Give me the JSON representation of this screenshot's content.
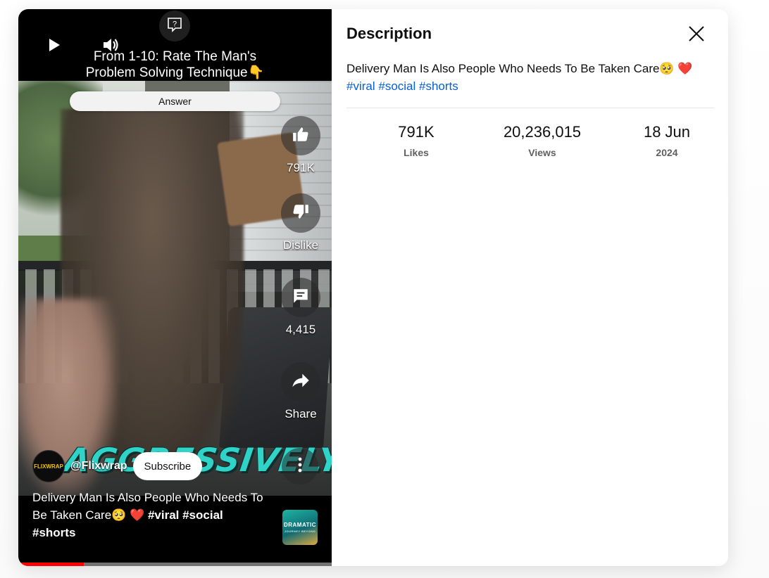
{
  "video": {
    "caption_line1": "From 1-10: Rate The Man's",
    "caption_line2": "Problem Solving Technique👇",
    "answer_label": "Answer",
    "overlay_text": "AGGRESSIVELY",
    "actions": {
      "like_count": "791K",
      "dislike_label": "Dislike",
      "comment_count": "4,415",
      "share_label": "Share"
    },
    "channel": {
      "avatar_text": "FLIXWRAP",
      "handle": "@Flixwrap",
      "subscribe_label": "Subscribe"
    },
    "title": "Delivery Man Is Also People Who Needs To Be Taken Care🥺",
    "title_heart": "❤️",
    "title_tags_1": "#viral #social",
    "title_tags_2": "#shorts",
    "sound_thumb_text": "DRAMATIC",
    "sound_thumb_sub": "JOURNEY BEYOND",
    "progress_fraction": 0.21,
    "icons": {
      "play": "play-icon",
      "volume": "volume-icon",
      "help": "question-icon",
      "like": "thumbs-up-icon",
      "dislike": "thumbs-down-icon",
      "comment": "comment-icon",
      "share": "share-icon",
      "more": "more-vertical-icon"
    }
  },
  "panel": {
    "title": "Description",
    "description_text": "Delivery Man Is Also People Who Needs To Be Taken Care🥺 ",
    "description_heart": "❤️",
    "hashtags": [
      "#viral",
      "#social",
      "#shorts"
    ],
    "stats": [
      {
        "value": "791K",
        "label": "Likes"
      },
      {
        "value": "20,236,015",
        "label": "Views"
      },
      {
        "value": "18 Jun",
        "label": "2024"
      }
    ],
    "close_icon": "close-icon"
  },
  "colors": {
    "link": "#065fd4",
    "progress": "#ff0000",
    "heart": "#e0253c"
  }
}
